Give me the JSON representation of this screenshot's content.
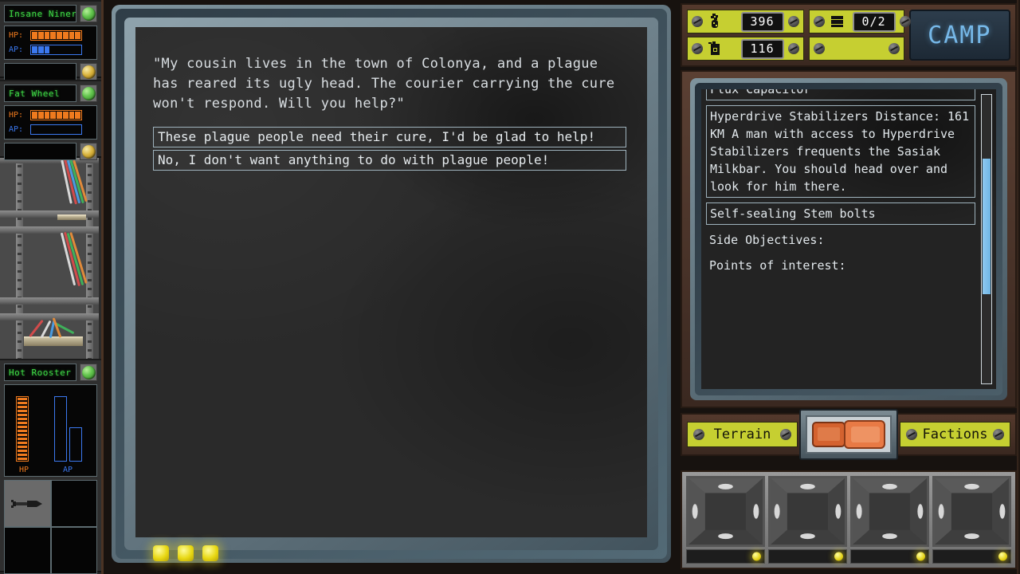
{
  "sidebar": {
    "characters": [
      {
        "name": "Insane Niner",
        "hp_label": "HP:",
        "ap_label": "AP:",
        "hp_segments": 8,
        "hp_max": 8,
        "ap_segments": 3,
        "ap_max": 8,
        "status_icon": "green-indicator-icon",
        "coin_icon": "gold-coin-icon"
      },
      {
        "name": "Fat Wheel",
        "hp_label": "HP:",
        "ap_label": "AP:",
        "hp_segments": 8,
        "hp_max": 8,
        "ap_segments": 0,
        "ap_max": 8,
        "status_icon": "green-indicator-icon",
        "coin_icon": "gold-coin-icon"
      }
    ],
    "third_character": {
      "name": "Hot Rooster",
      "status_icon": "green-indicator-icon",
      "hp_label": "HP",
      "ap_label": "AP",
      "hp_fill_percent": 100,
      "ap_bar_tall_percent": 100,
      "ap_bar_short_percent": 52,
      "inventory_slots": [
        {
          "item_icon": "wrench-tool-icon",
          "filled": true
        },
        {
          "item_icon": "",
          "filled": false
        },
        {
          "item_icon": "",
          "filled": false
        },
        {
          "item_icon": "",
          "filled": false
        }
      ]
    }
  },
  "dialogue": {
    "body": "\"My cousin lives in the town of Colonya, and a plague has reared its ugly head. The courier carrying the cure won't respond. Will you help?\"",
    "options": [
      "These plague people need their cure, I'd be glad to help!",
      "No, I don't want anything to do with plague people!"
    ],
    "indicator_lights": 3
  },
  "hud": {
    "money": {
      "icon": "money-pouch-icon",
      "value": "396"
    },
    "cargo": {
      "icon": "cargo-crate-icon",
      "value": "0/2"
    },
    "fuel": {
      "icon": "fuel-can-icon",
      "value": "116"
    },
    "empty_slot": {
      "icon": "",
      "value": ""
    },
    "camp_button": "CAMP"
  },
  "quest_log": {
    "entries": [
      {
        "text": "Flux Capacitor",
        "boxed": true,
        "clipped": true
      },
      {
        "text": "Hyperdrive Stabilizers\n\nDistance: 161 KM\n\nA man with access to\nHyperdrive Stabilizers\nfrequents the Sasiak Milkbar.\n\nYou should head over and\nlook for him there.",
        "boxed": true,
        "clipped": false
      },
      {
        "text": "Self-sealing Stem bolts",
        "boxed": true,
        "clipped": false
      },
      {
        "text": "Side Objectives:",
        "boxed": false,
        "clipped": false
      },
      {
        "text": "Points of interest:",
        "boxed": false,
        "clipped": false
      }
    ],
    "scrollbar": {
      "thumb_top_percent": 22,
      "thumb_height_percent": 47
    }
  },
  "tabs": {
    "left_tab": "Terrain",
    "vehicle_icon": "vehicle-truck-icon",
    "right_tab": "Factions"
  },
  "equipment": {
    "slots": [
      {
        "content_icon": "empty-crate-icon",
        "led": "yellow-led-icon"
      },
      {
        "content_icon": "empty-crate-icon",
        "led": "yellow-led-icon"
      },
      {
        "content_icon": "empty-crate-icon",
        "led": "yellow-led-icon"
      },
      {
        "content_icon": "empty-crate-icon",
        "led": "yellow-led-icon"
      }
    ]
  },
  "colors": {
    "hud_yellow": "#c6cf31",
    "hp_orange": "#ef7a1e",
    "ap_blue": "#3b78ef",
    "name_green": "#3fdc46",
    "camp_blue": "#76b8e8",
    "screen_text": "#e2e8ec",
    "frame_brown": "#4a3324",
    "vehicle_orange": "#e06a3a"
  }
}
